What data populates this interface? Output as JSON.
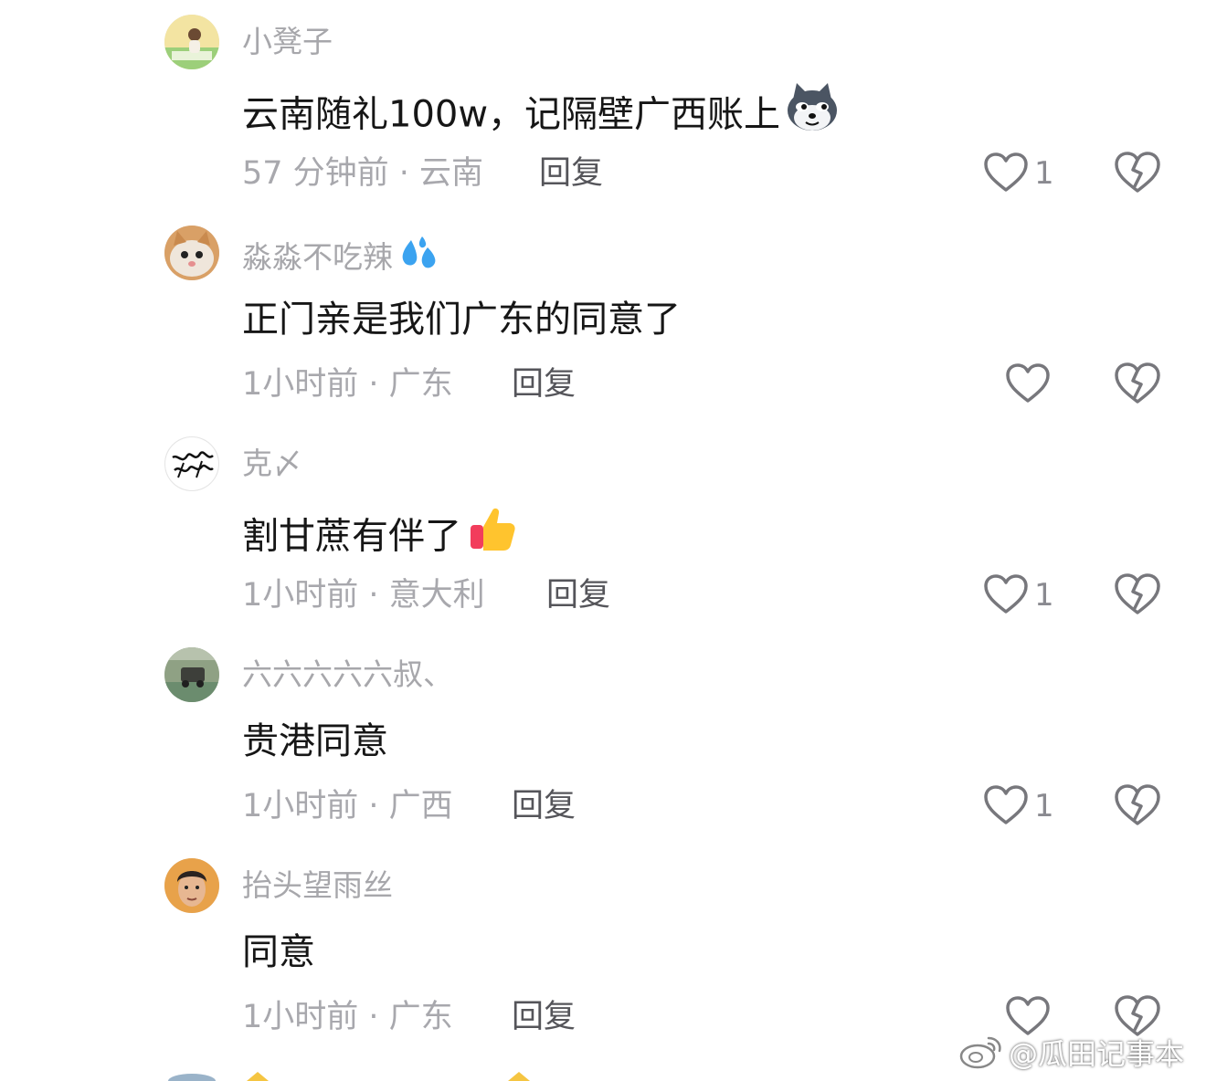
{
  "comments": [
    {
      "username": "小凳子",
      "content": "云南随礼100w，记隔壁广西账上",
      "time_location": "57 分钟前 · 云南",
      "reply_label": "回复",
      "like_count": "1"
    },
    {
      "username": "淼淼不吃辣",
      "content": "正门亲是我们广东的同意了",
      "time_location": "1小时前 · 广东",
      "reply_label": "回复",
      "like_count": ""
    },
    {
      "username": "克〆",
      "content": "割甘蔗有伴了",
      "time_location": "1小时前 · 意大利",
      "reply_label": "回复",
      "like_count": "1"
    },
    {
      "username": "六六六六六叔、",
      "content": "贵港同意",
      "time_location": "1小时前 · 广西",
      "reply_label": "回复",
      "like_count": "1"
    },
    {
      "username": "抬头望雨丝",
      "content": "同意",
      "time_location": "1小时前 · 广东",
      "reply_label": "回复",
      "like_count": ""
    }
  ],
  "watermark": "@瓜田记事本",
  "icons": {
    "like": "heart-outline-icon",
    "dislike": "broken-heart-icon"
  },
  "colors": {
    "username": "#a7a7ab",
    "content": "#161616",
    "meta": "#a8a8ad",
    "reply": "#55555a",
    "icon_stroke": "#77777c"
  }
}
